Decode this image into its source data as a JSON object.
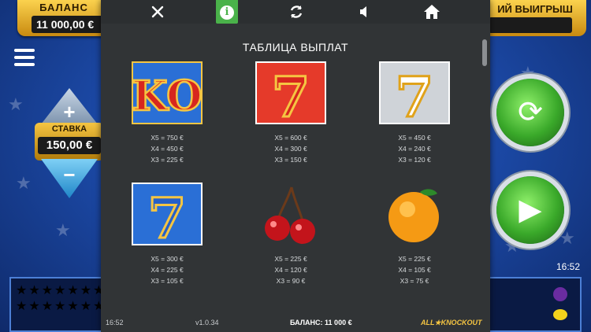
{
  "game": {
    "balance_label": "БАЛАНС",
    "balance_value": "11 000,00 €",
    "win_label": "ИЙ ВЫИГРЫШ",
    "stake_label": "СТАВКА",
    "stake_value": "150,00 €",
    "clock": "16:52"
  },
  "toolbar": {
    "close_icon": "close-icon",
    "info_icon": "info-icon",
    "autoplay_icon": "autoplay-icon",
    "sound_icon": "sound-icon",
    "home_icon": "home-icon",
    "info_glyph": "i"
  },
  "paytable": {
    "title": "ТАБЛИЦА ВЫПЛАТ",
    "symbols": [
      {
        "name": "ko",
        "pays": [
          "X5 = 750 €",
          "X4 = 450 €",
          "X3 = 225 €"
        ]
      },
      {
        "name": "red-seven",
        "pays": [
          "X5 = 600 €",
          "X4 = 300 €",
          "X3 = 150 €"
        ]
      },
      {
        "name": "silver-seven",
        "pays": [
          "X5 = 450 €",
          "X4 = 240 €",
          "X3 = 120 €"
        ]
      },
      {
        "name": "blue-seven",
        "pays": [
          "X5 = 300 €",
          "X4 = 225 €",
          "X3 = 105 €"
        ]
      },
      {
        "name": "cherry",
        "pays": [
          "X5 = 225 €",
          "X4 = 120 €",
          "X3 = 90 €"
        ]
      },
      {
        "name": "orange",
        "pays": [
          "X5 = 225 €",
          "X4 = 105 €",
          "X3 = 75 €"
        ]
      }
    ]
  },
  "footer": {
    "time": "16:52",
    "version": "v1.0.34",
    "balance": "БАЛАНС: 11 000 €",
    "logo": "ALL★KNOCKOUT"
  },
  "colors": {
    "panel_bg": "#313436",
    "info_active": "#4ab24a",
    "game_gold": "#f5c542",
    "game_blue": "#1c4aa8"
  }
}
